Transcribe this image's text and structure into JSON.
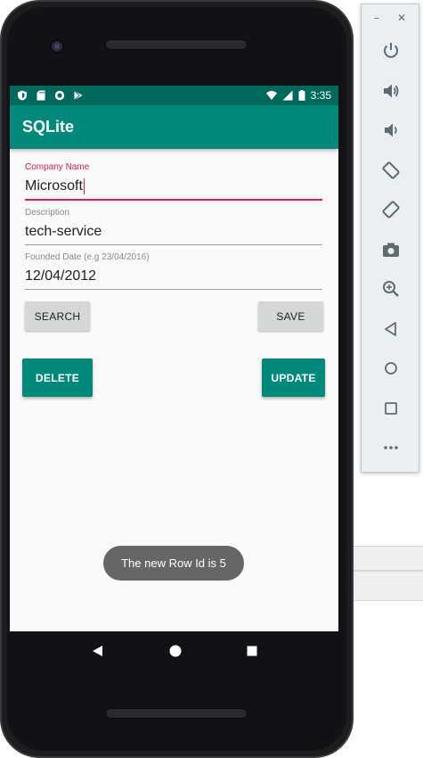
{
  "status_bar": {
    "time": "3:35"
  },
  "app": {
    "title": "SQLite"
  },
  "form": {
    "company": {
      "label": "Company Name",
      "value": "Microsoft"
    },
    "description": {
      "label": "Description",
      "value": "tech-service"
    },
    "founded": {
      "label": "Founded Date (e.g 23/04/2016)",
      "value": "12/04/2012"
    }
  },
  "buttons": {
    "search": "SEARCH",
    "save": "SAVE",
    "delete": "DELETE",
    "update": "UPDATE"
  },
  "toast": {
    "message": "The new Row Id is 5"
  },
  "emulator_toolbar": {
    "minimize": "–",
    "close": "✕",
    "items": [
      "power-icon",
      "volume-up-icon",
      "volume-down-icon",
      "rotate-left-icon",
      "rotate-right-icon",
      "camera-icon",
      "zoom-icon",
      "back-icon",
      "home-icon",
      "overview-icon",
      "more-icon"
    ]
  },
  "colors": {
    "primary": "#00897b",
    "primary_dark": "#00695c",
    "accent": "#d81b60"
  }
}
